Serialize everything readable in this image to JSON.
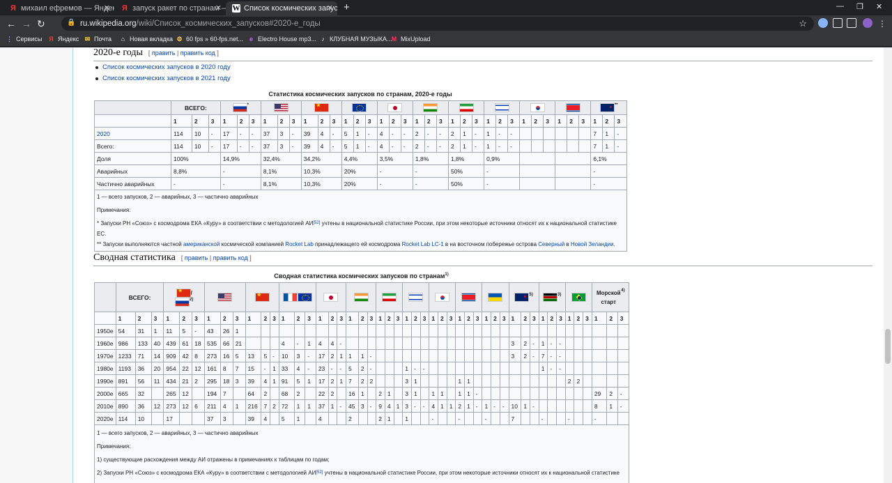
{
  "browser": {
    "tabs": [
      {
        "title": "михаил ефремов — Яндекс: на",
        "favicon": "Я"
      },
      {
        "title": "запуск ракет по странам — Янд",
        "favicon": "Я"
      },
      {
        "title": "Список космических запусков",
        "favicon": "W"
      }
    ],
    "url_domain": "ru.wikipedia.org",
    "url_path": "/wiki/Список_космических_запусков#2020-е_годы",
    "bookmarks": [
      {
        "label": "Сервисы",
        "icon": "apps-icon"
      },
      {
        "label": "Яндекс",
        "icon": "yandex-icon"
      },
      {
        "label": "Почта",
        "icon": "mail-icon"
      },
      {
        "label": "Новая вкладка",
        "icon": "newtab-icon"
      },
      {
        "label": "60 fps » 60-fps.net...",
        "icon": "bookmark-icon"
      },
      {
        "label": "Electro House mp3...",
        "icon": "bookmark-icon"
      },
      {
        "label": "КЛУБНАЯ МУЗЫКА...",
        "icon": "bookmark-icon"
      },
      {
        "label": "MixUpload",
        "icon": "mixupload-icon"
      }
    ]
  },
  "section1": {
    "heading": "2020-е годы",
    "edit": "[ править | править код ]",
    "edit_a": "править",
    "edit_b": "править код",
    "links": [
      "Список космических запусков в 2020 году",
      "Список космических запусков в 2021 году"
    ],
    "table_caption": "Статистика космических запусков по странам, 2020-е годы",
    "total_label": "ВСЕГО:",
    "flags": [
      "ru",
      "us",
      "cn",
      "eu",
      "jp",
      "in",
      "ir",
      "il",
      "kr",
      "kp",
      "nz"
    ],
    "flag_marks": {
      "ru": "*",
      "nz": "**"
    },
    "subheaders": [
      "1",
      "2",
      "3"
    ],
    "rows": [
      {
        "label": "2020",
        "link": true,
        "cells": [
          "114",
          "10",
          "-",
          "17",
          "-",
          "-",
          "37",
          "3",
          "-",
          "39",
          "4",
          "-",
          "5",
          "1",
          "-",
          "4",
          "-",
          "-",
          "2",
          "-",
          "-",
          "2",
          "1",
          "-",
          "1",
          "-",
          "-",
          "",
          "",
          "",
          "",
          "",
          "",
          "7",
          "1",
          "-"
        ]
      },
      {
        "label": "Всего:",
        "link": false,
        "cells": [
          "114",
          "10",
          "-",
          "17",
          "-",
          "-",
          "37",
          "3",
          "-",
          "39",
          "4",
          "-",
          "5",
          "1",
          "-",
          "4",
          "-",
          "-",
          "2",
          "-",
          "-",
          "2",
          "1",
          "-",
          "1",
          "-",
          "-",
          "",
          "",
          "",
          "",
          "",
          "",
          "7",
          "1",
          "-"
        ]
      }
    ],
    "share_rows": [
      {
        "label": "Доля",
        "cells": [
          "100%",
          "14,9%",
          "32,4%",
          "34,2%",
          "4,4%",
          "3,5%",
          "1,8%",
          "1,8%",
          "0,9%",
          "",
          "",
          "6,1%"
        ]
      },
      {
        "label": "Аварийных",
        "cells": [
          "8,8%",
          "-",
          "8,1%",
          "10,3%",
          "20%",
          "-",
          "-",
          "50%",
          "-",
          "",
          "",
          "-"
        ]
      },
      {
        "label": "Частично аварийных",
        "cells": [
          "-",
          "-",
          "8,1%",
          "10,3%",
          "20%",
          "-",
          "-",
          "50%",
          "-",
          "",
          "",
          "-"
        ]
      }
    ],
    "legend": "1 — всего запусков, 2 — аварийных, 3 — частично аварийных",
    "notes_title": "Примечания:",
    "note1": "* Запуски РН «Союз» с космодрома ЕКА «Куру» в соответствии с методологией АИ",
    "note1_ref": "[52]",
    "note1_tail": " учтены в национальной статистике России, при этом некоторые источники относят их к национальной статистике ЕС.",
    "note2_parts": [
      "** Запуски выполняются частной ",
      "американской",
      " космической компанией ",
      "Rocket Lab",
      " принадлежащего ей космодрома ",
      "Rocket Lab LC-1",
      " в на восточном побережье острова ",
      "Северный",
      " в ",
      "Новой Зеландии",
      "."
    ]
  },
  "section2": {
    "heading": "Сводная статистика",
    "edit": "[ править | править код ]",
    "table_caption": "Сводная статистика космических запусков по странам",
    "caption_ref": "1)",
    "total_label": "ВСЕГО:",
    "flags": [
      "cn-ru",
      "us",
      "cn",
      "fr-eu",
      "jp",
      "in",
      "ir",
      "il",
      "kr",
      "kp",
      "ua",
      "nz",
      "ke",
      "br",
      "sea"
    ],
    "flag_refs": {
      "cn-ru": "2)",
      "nz": "5)",
      "ke": "3)",
      "sea": "4)"
    },
    "sea_label": "Морской старт",
    "rows": [
      {
        "label": "1950е",
        "cells": [
          "54",
          "31",
          "1",
          "11",
          "5",
          "-",
          "43",
          "26",
          "1",
          "",
          "",
          "",
          "",
          "",
          "",
          "",
          "",
          "",
          "",
          "",
          "",
          "",
          "",
          "",
          "",
          "",
          "",
          "",
          "",
          "",
          "",
          "",
          "",
          "",
          "",
          "",
          "",
          "",
          "",
          "",
          "",
          "",
          "",
          "",
          "",
          "",
          "",
          ""
        ]
      },
      {
        "label": "1960е",
        "cells": [
          "986",
          "133",
          "40",
          "439",
          "61",
          "18",
          "535",
          "66",
          "21",
          "",
          "",
          "",
          "4",
          "-",
          "1",
          "4",
          "4",
          "-",
          "",
          "",
          "",
          "",
          "",
          "",
          "",
          "",
          "",
          "",
          "",
          "",
          "",
          "",
          "",
          "",
          "",
          "",
          "3",
          "2",
          "-",
          "1",
          "-",
          "-",
          "",
          "",
          "",
          "",
          "",
          ""
        ]
      },
      {
        "label": "1970е",
        "cells": [
          "1233",
          "71",
          "14",
          "909",
          "42",
          "8",
          "273",
          "16",
          "5",
          "13",
          "5",
          "-",
          "10",
          "3",
          "-",
          "17",
          "2",
          "1",
          "1",
          "1",
          "-",
          "",
          "",
          "",
          "",
          "",
          "",
          "",
          "",
          "",
          "",
          "",
          "",
          "",
          "",
          "",
          "3",
          "2",
          "-",
          "7",
          "-",
          "-",
          "",
          "",
          "",
          "",
          "",
          ""
        ]
      },
      {
        "label": "1980е",
        "cells": [
          "1193",
          "36",
          "20",
          "954",
          "22",
          "12",
          "161",
          "8",
          "7",
          "15",
          "-",
          "1",
          "33",
          "4",
          "-",
          "23",
          "-",
          "-",
          "5",
          "2",
          "-",
          "",
          "",
          "",
          "1",
          "-",
          "-",
          "",
          "",
          "",
          "",
          "",
          "",
          "",
          "",
          "",
          "",
          "",
          "",
          "1",
          "-",
          "-",
          "",
          "",
          "",
          "",
          "",
          ""
        ]
      },
      {
        "label": "1990е",
        "cells": [
          "891",
          "56",
          "11",
          "434",
          "21",
          "2",
          "295",
          "18",
          "3",
          "39",
          "4",
          "1",
          "91",
          "5",
          "1",
          "17",
          "2",
          "1",
          "7",
          "2",
          "2",
          "",
          "",
          "",
          "3",
          "1",
          "",
          "",
          "",
          "",
          "1",
          "1",
          "",
          "",
          "",
          "",
          "",
          "",
          "",
          "",
          "",
          "",
          "2",
          "2",
          "",
          "",
          "",
          ""
        ]
      },
      {
        "label": "2000е",
        "cells": [
          "665",
          "32",
          "",
          "265",
          "12",
          "",
          "194",
          "7",
          "",
          "64",
          "2",
          "",
          "68",
          "2",
          "",
          "22",
          "2",
          "",
          "16",
          "1",
          "",
          "2",
          "1",
          "",
          "3",
          "1",
          "",
          "1",
          "1",
          "",
          "1",
          "1",
          "-",
          "",
          "",
          "",
          "",
          "",
          "",
          "",
          "",
          "",
          "",
          "",
          "",
          "29",
          "2",
          "-"
        ]
      },
      {
        "label": "2010е",
        "cells": [
          "890",
          "36",
          "12",
          "273",
          "12",
          "6",
          "211",
          "4",
          "1",
          "216",
          "7",
          "2",
          "72",
          "1",
          "1",
          "37",
          "1",
          "-",
          "45",
          "3",
          "-",
          "9",
          "4",
          "1",
          "3",
          "-",
          "-",
          "4",
          "1",
          "1",
          "2",
          "1",
          "-",
          "1",
          "-",
          "-",
          "10",
          "1",
          "-",
          "",
          "",
          "",
          "",
          "",
          "",
          "8",
          "1",
          "-"
        ]
      },
      {
        "label": "2020е",
        "cells": [
          "114",
          "10",
          "",
          "17",
          "",
          "",
          "37",
          "3",
          "",
          "39",
          "4",
          "",
          "5",
          "1",
          "",
          "4",
          "",
          "",
          "2",
          "",
          "",
          "2",
          "1",
          "",
          "1",
          "",
          "",
          "-",
          "",
          "",
          "-",
          "",
          "",
          "-",
          "",
          "",
          "7",
          "",
          "",
          "-",
          "",
          "",
          "-",
          "",
          "",
          "-",
          "",
          ""
        ]
      }
    ],
    "legend": "1 — всего запусков, 2 — аварийных, 3 — частично аварийных",
    "notes_title": "Примечания:",
    "note1": "1) существующие расхождения между АИ отражены в примечаниях к таблицам по годам;",
    "note2": "2) Запуски РН «Союз» с космодрома ЕКА «Куру» в соответствии с методологией АИ",
    "note2_ref": "[52]",
    "note2_tail": " учтены в национальной статистике России, при этом некоторые источники относят их к национальной статистике ЕС."
  }
}
